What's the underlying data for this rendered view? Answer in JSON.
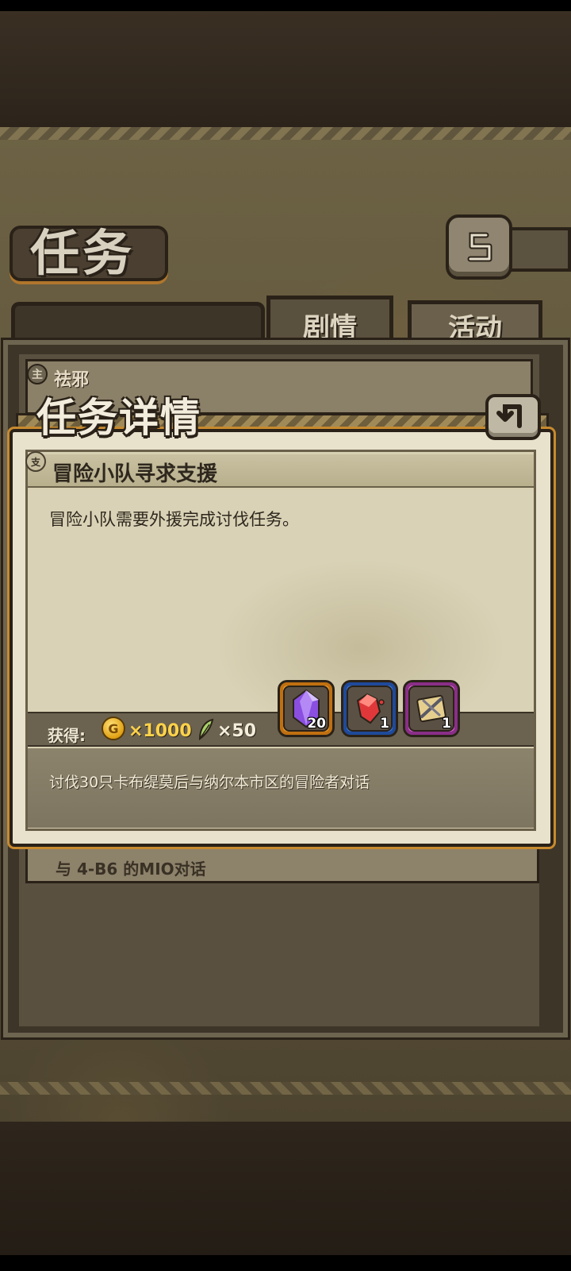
{
  "screen": {
    "title": "任务",
    "tabs": [
      {
        "label": "剧情",
        "active": true
      },
      {
        "label": "活动",
        "active": false
      }
    ],
    "background_list": {
      "top_item_icon": "主",
      "top_item_label": "祛邪",
      "bottom_item_label": "与 4-B6 的MIO对话"
    }
  },
  "modal": {
    "title": "任务详情",
    "quest_icon": "支",
    "quest_title": "冒险小队寻求支援",
    "quest_description": "冒险小队需要外援完成讨伐任务。",
    "rewards": {
      "label": "获得:",
      "coin_icon_letter": "G",
      "coin_amount": "×1000",
      "leaf_amount": "×50",
      "items": [
        {
          "name": "purple-crystal",
          "count": "20",
          "frame": "orange"
        },
        {
          "name": "red-gem-fragment",
          "count": "1",
          "frame": "blue"
        },
        {
          "name": "weapon-scroll",
          "count": "1",
          "frame": "purple"
        }
      ]
    },
    "condition": "讨伐30只卡布缇莫后与纳尔本市区的冒险者对话"
  },
  "colors": {
    "accent_orange": "#c78a2e",
    "coin_gold": "#ffd24a",
    "frame_dark": "#2a2218"
  }
}
